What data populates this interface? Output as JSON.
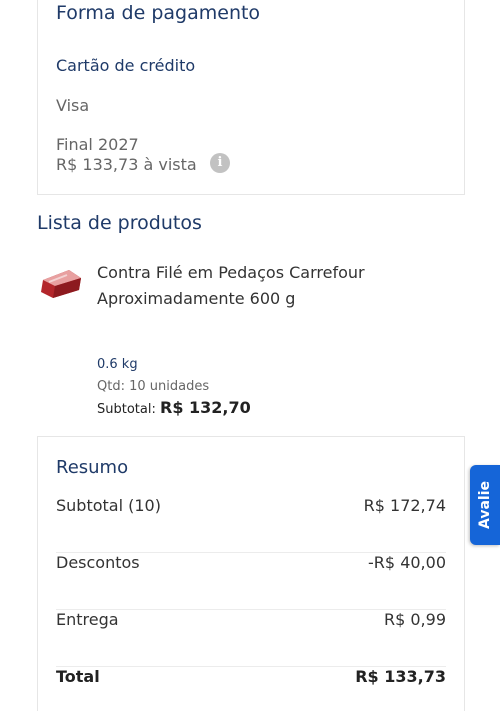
{
  "payment": {
    "title": "Forma de pagamento",
    "method": "Cartão de crédito",
    "brand": "Visa",
    "final": "Final 2027",
    "amount": "R$ 133,73 à vista",
    "info_icon": "info-icon"
  },
  "products": {
    "title": "Lista de produtos",
    "items": [
      {
        "name": "Contra Filé em Pedaços Carrefour Aproximadamente 600 g",
        "weight": "0.6 kg",
        "quantity": "Qtd: 10 unidades",
        "subtotal_label": "Subtotal:",
        "subtotal_value": "R$ 132,70"
      }
    ]
  },
  "summary": {
    "title": "Resumo",
    "rows": [
      {
        "label": "Subtotal (10)",
        "value": "R$ 172,74"
      },
      {
        "label": "Descontos",
        "value": "-R$ 40,00"
      },
      {
        "label": "Entrega",
        "value": "R$ 0,99"
      },
      {
        "label": "Total",
        "value": "R$ 133,73"
      }
    ]
  },
  "feedback_tab": {
    "label": "Avalie",
    "color": "#1565d8"
  },
  "colors": {
    "heading": "#1f3a68",
    "text": "#333333",
    "muted": "#666666",
    "border": "#e6e6e6"
  }
}
